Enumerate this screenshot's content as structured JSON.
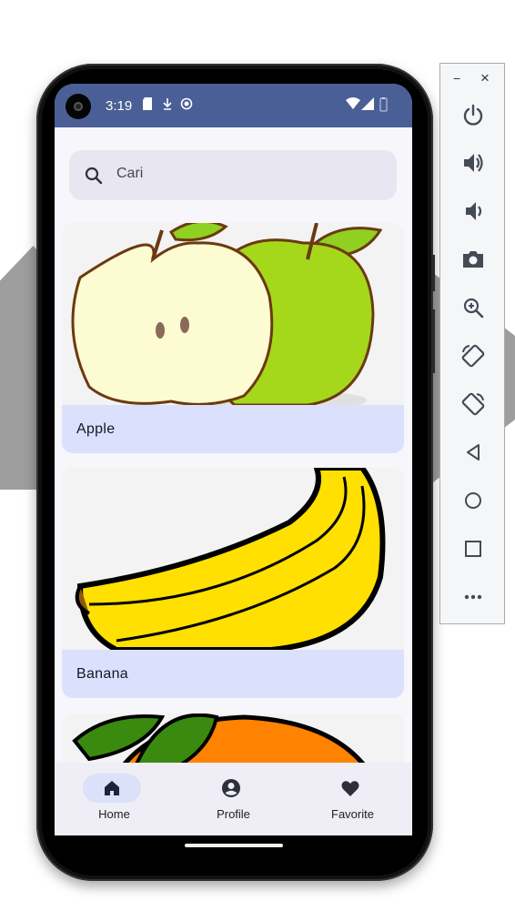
{
  "status_bar": {
    "time": "3:19"
  },
  "search": {
    "placeholder": "Cari"
  },
  "fruits": [
    {
      "name": "Apple"
    },
    {
      "name": "Banana"
    },
    {
      "name": "Orange"
    }
  ],
  "bottom_nav": {
    "home": "Home",
    "profile": "Profile",
    "favorite": "Favorite",
    "selected": "Home"
  },
  "emulator_panel": {
    "minimize": "−",
    "close": "×",
    "buttons": [
      "power-icon",
      "volume-up-icon",
      "volume-down-icon",
      "camera-icon",
      "zoom-icon",
      "rotate-left-icon",
      "rotate-right-icon",
      "back-icon",
      "home-icon",
      "overview-icon",
      "more-icon"
    ]
  },
  "colors": {
    "status_bar": "#4a5f96",
    "card_label": "#dbe1fc",
    "nav_selected": "#dbe1f8",
    "icon_dark": "#1c2340"
  }
}
